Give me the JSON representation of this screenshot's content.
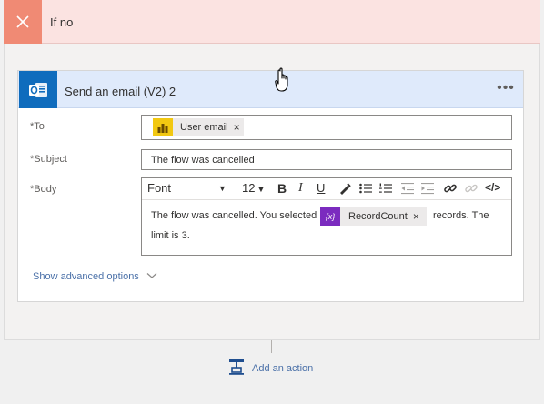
{
  "condition": {
    "title": "If no"
  },
  "action": {
    "title": "Send an email (V2) 2",
    "more_label": "•••"
  },
  "fields": {
    "to": {
      "label": "To",
      "token_label": "User email",
      "token_remove": "×"
    },
    "subject": {
      "label": "Subject",
      "value": "The flow was cancelled"
    },
    "body": {
      "label": "Body",
      "toolbar": {
        "font": "Font",
        "size": "12",
        "bold": "B",
        "italic": "I",
        "underline": "U",
        "code": "</>"
      },
      "text_before": "The flow was cancelled.  You selected",
      "token_label": "RecordCount",
      "token_remove": "×",
      "token_icon_text": "{x}",
      "text_after": "records.  The",
      "text_line2": "limit is 3."
    }
  },
  "advanced_label": "Show advanced options",
  "add_action_label": "Add an action",
  "required_marker": "*"
}
